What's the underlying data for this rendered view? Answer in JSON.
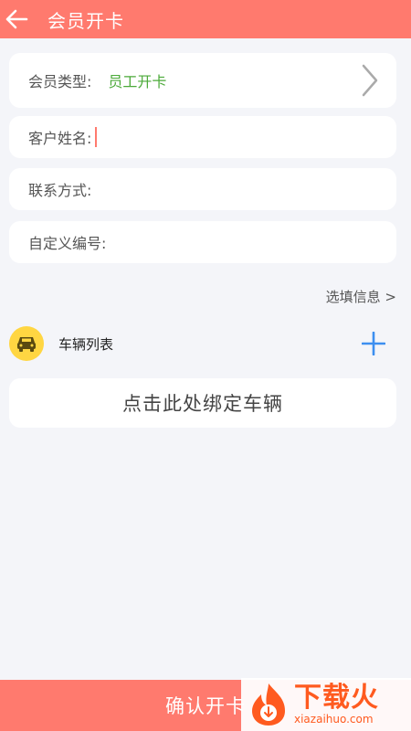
{
  "header": {
    "title": "会员开卡",
    "back_icon": "arrow-left-icon"
  },
  "form": {
    "member_type": {
      "label": "会员类型:",
      "value": "员工开卡"
    },
    "customer_name": {
      "label": "客户姓名:",
      "value": ""
    },
    "contact": {
      "label": "联系方式:",
      "value": ""
    },
    "custom_number": {
      "label": "自定义编号:",
      "value": ""
    }
  },
  "optional_info": "选填信息 >",
  "vehicle": {
    "title": "车辆列表",
    "bind_prompt": "点击此处绑定车辆"
  },
  "confirm_label": "确认开卡",
  "watermark": {
    "text": "下载火",
    "sub": "xiazaihuo.com"
  },
  "colors": {
    "accent": "#ff7a6e",
    "value_green": "#4caa3a",
    "car_badge": "#ffd642",
    "plus_blue": "#3d8ff0"
  }
}
